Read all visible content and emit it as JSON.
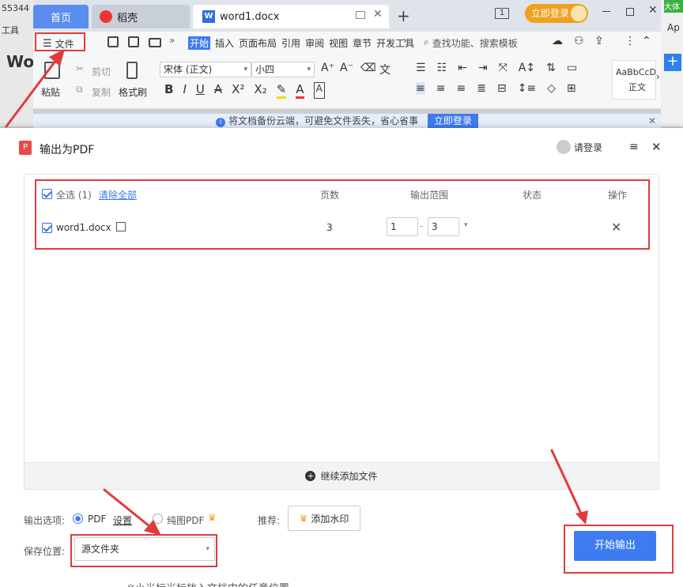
{
  "background": {
    "left_edge_top": "55344",
    "left_edge_mid": "工具",
    "left_edge_big": "Wo",
    "right_edge_top": "大体",
    "right_edge_mid": "Ap",
    "bottom_text": "※小光标光标放入文档中的任意位置"
  },
  "tabbar": {
    "tabs": [
      {
        "label": "首页"
      },
      {
        "label": "稻壳"
      },
      {
        "label": "word1.docx"
      }
    ],
    "page_indicator": "1",
    "login_label": "立即登录"
  },
  "toolbar": {
    "file_label": "文件",
    "menus": [
      "开始",
      "插入",
      "页面布局",
      "引用",
      "审阅",
      "视图",
      "章节",
      "开发工具"
    ],
    "search_placeholder": "查找功能、搜索模板",
    "paste_label": "粘贴",
    "cut_label": "剪切",
    "copy_label": "复制",
    "format_brush_label": "格式刷",
    "font_name": "宋体 (正文)",
    "font_size": "小四",
    "style_preview": "AaBbCcD",
    "style_name": "正文"
  },
  "notice": {
    "text": "将文档备份云端，可避免文件丢失，省心省事",
    "login_button": "立即登录"
  },
  "dialog": {
    "title": "输出为PDF",
    "login_label": "请登录",
    "table": {
      "select_all": "全选 (1)",
      "clear_all": "清除全部",
      "col_pages": "页数",
      "col_range": "输出范围",
      "col_status": "状态",
      "col_action": "操作",
      "rows": [
        {
          "name": "word1.docx",
          "pages": "3",
          "range_from": "1",
          "range_to": "3",
          "status": ""
        }
      ]
    },
    "add_files_label": "继续添加文件",
    "output_options_label": "输出选项:",
    "option_pdf": "PDF",
    "settings_link": "设置",
    "option_image_pdf": "纯图PDF",
    "recommend_label": "推荐:",
    "watermark_button": "添加水印",
    "save_location_label": "保存位置:",
    "save_location_value": "源文件夹",
    "start_button": "开始输出"
  },
  "colors": {
    "accent": "#3e7bf0",
    "annotation_red": "#e23b3b",
    "login_orange": "#f0a020"
  }
}
